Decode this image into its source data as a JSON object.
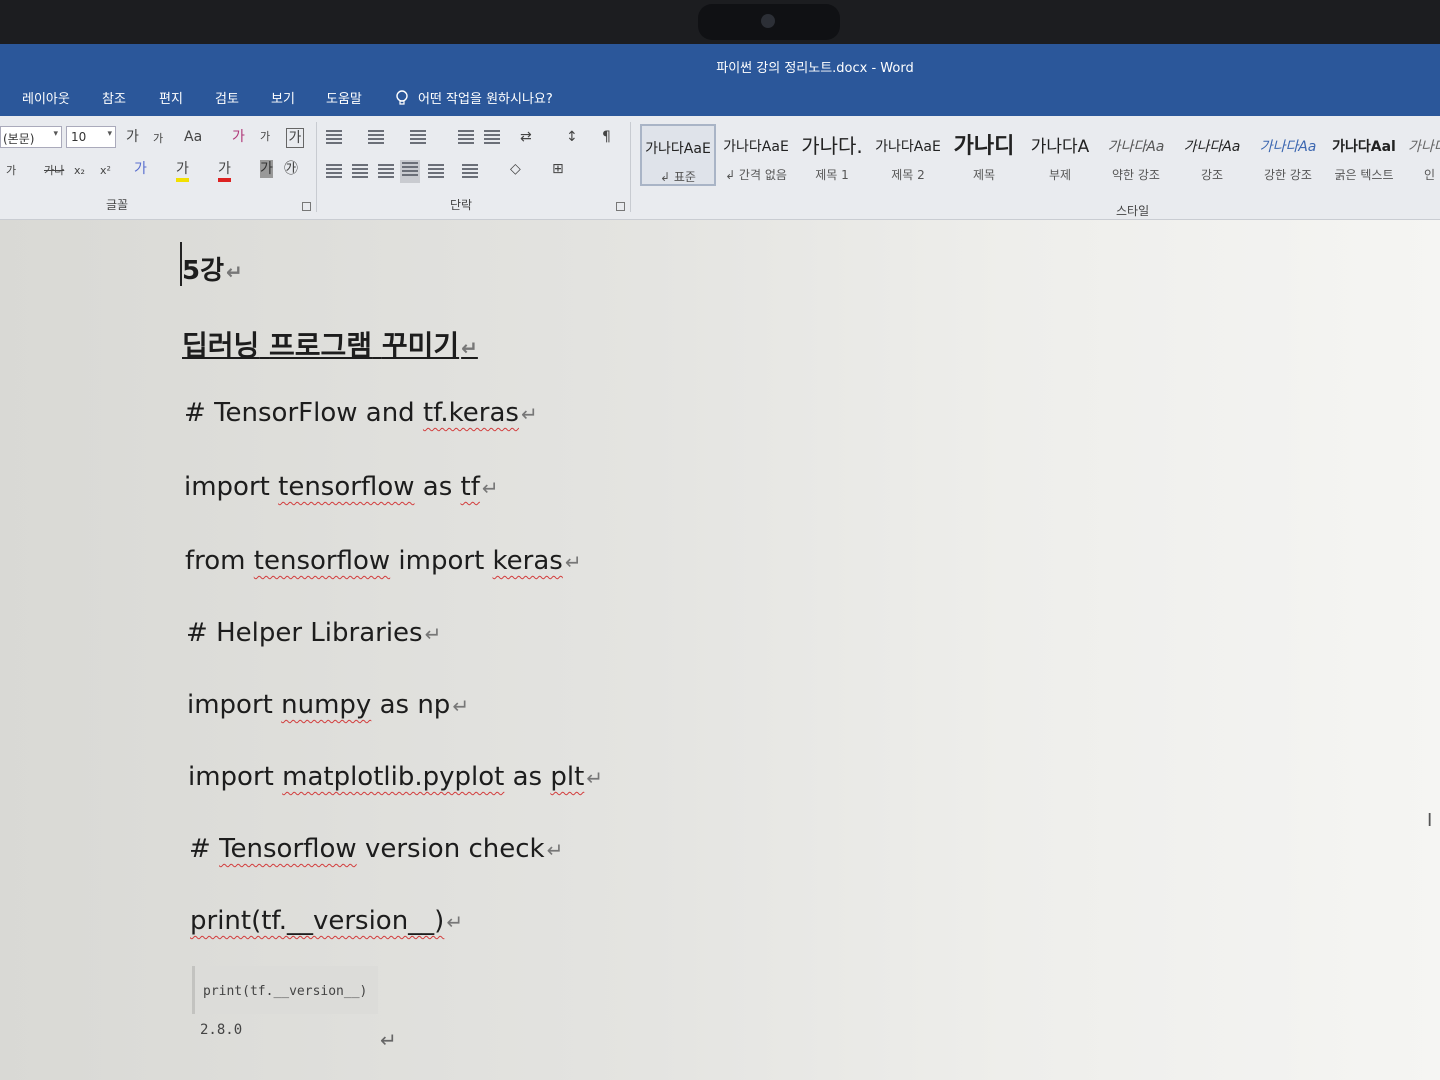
{
  "window": {
    "title": "파이썬 강의 정리노트.docx  -  Word"
  },
  "tabs": [
    "레이아웃",
    "참조",
    "편지",
    "검토",
    "보기",
    "도움말"
  ],
  "tell_me": "어떤 작업을 원하시나요?",
  "font_group": {
    "font_name": "(본문)",
    "font_size": "10",
    "grow": "가",
    "shrink": "가",
    "change_case": "Aa",
    "phonetic": "가",
    "enclose": "가",
    "bold_char": "가",
    "strike": "가나",
    "sub": "x₂",
    "sup": "x²",
    "highlight": "가",
    "font_color": "가",
    "shade": "가",
    "circle": "㉮",
    "label": "글꼴"
  },
  "paragraph_group": {
    "label": "단락",
    "sort": "↕",
    "pilcrow": "¶"
  },
  "styles": {
    "label": "스타일",
    "items": [
      {
        "preview": "가나다AaE",
        "name": "↲ 표준"
      },
      {
        "preview": "가나다AaE",
        "name": "↲ 간격 없음"
      },
      {
        "preview": "가나다.",
        "name": "제목 1"
      },
      {
        "preview": "가나다AaE",
        "name": "제목 2"
      },
      {
        "preview": "가나디",
        "name": "제목"
      },
      {
        "preview": "가나다A",
        "name": "부제"
      },
      {
        "preview": "가나다Aa",
        "name": "약한 강조"
      },
      {
        "preview": "가나다Aa",
        "name": "강조"
      },
      {
        "preview": "가나다Aa",
        "name": "강한 강조"
      },
      {
        "preview": "가나다Aal",
        "name": "굵은 텍스트"
      },
      {
        "preview": "가나다",
        "name": "인"
      }
    ]
  },
  "document": {
    "lines": [
      "5강",
      "딥러닝 프로그램 꾸미기",
      "# TensorFlow and tf.keras",
      "import tensorflow as tf",
      "from tensorflow import keras",
      "# Helper Libraries",
      "import numpy as np",
      "import matplotlib.pyplot as plt",
      "# Tensorflow version check",
      "print(tf.__version__)"
    ],
    "code_cell": "print(tf.__version__)",
    "code_output": "2.8.0",
    "para_mark": "↵"
  },
  "colors": {
    "ribbon_blue": "#2b579a",
    "spell_squiggle": "#d23b3b"
  }
}
